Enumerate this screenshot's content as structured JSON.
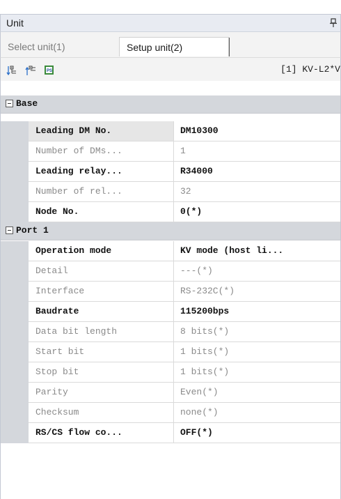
{
  "panel": {
    "title": "Unit"
  },
  "tabs": [
    {
      "label": "Select unit(1)"
    },
    {
      "label": "Setup unit(2)"
    }
  ],
  "toolbar": {
    "icons": [
      "expand-tree-icon",
      "collapse-tree-icon",
      "ps-settings-icon"
    ],
    "unit_label": "[1] KV-L2*V"
  },
  "groups": [
    {
      "title": "Base",
      "rows": [
        {
          "name": "Leading DM No.",
          "value": "DM10300",
          "editable": true
        },
        {
          "name": "Number of DMs...",
          "value": "1",
          "editable": false
        },
        {
          "name": "Leading relay...",
          "value": "R34000",
          "editable": true
        },
        {
          "name": "Number of rel...",
          "value": "32",
          "editable": false
        },
        {
          "name": "Node No.",
          "value": "0(*)",
          "editable": true
        }
      ]
    },
    {
      "title": "Port 1",
      "rows": [
        {
          "name": "Operation mode",
          "value": "KV mode (host li...",
          "editable": true
        },
        {
          "name": "Detail",
          "value": "---(*)",
          "editable": false
        },
        {
          "name": "Interface",
          "value": "RS-232C(*)",
          "editable": false
        },
        {
          "name": "Baudrate",
          "value": "115200bps",
          "editable": true
        },
        {
          "name": "Data bit length",
          "value": "8 bits(*)",
          "editable": false
        },
        {
          "name": "Start bit",
          "value": "1 bits(*)",
          "editable": false
        },
        {
          "name": "Stop bit",
          "value": "1 bits(*)",
          "editable": false
        },
        {
          "name": "Parity",
          "value": "Even(*)",
          "editable": false
        },
        {
          "name": "Checksum",
          "value": "none(*)",
          "editable": false
        },
        {
          "name": "RS/CS flow co...",
          "value": "OFF(*)",
          "editable": true
        }
      ]
    }
  ]
}
